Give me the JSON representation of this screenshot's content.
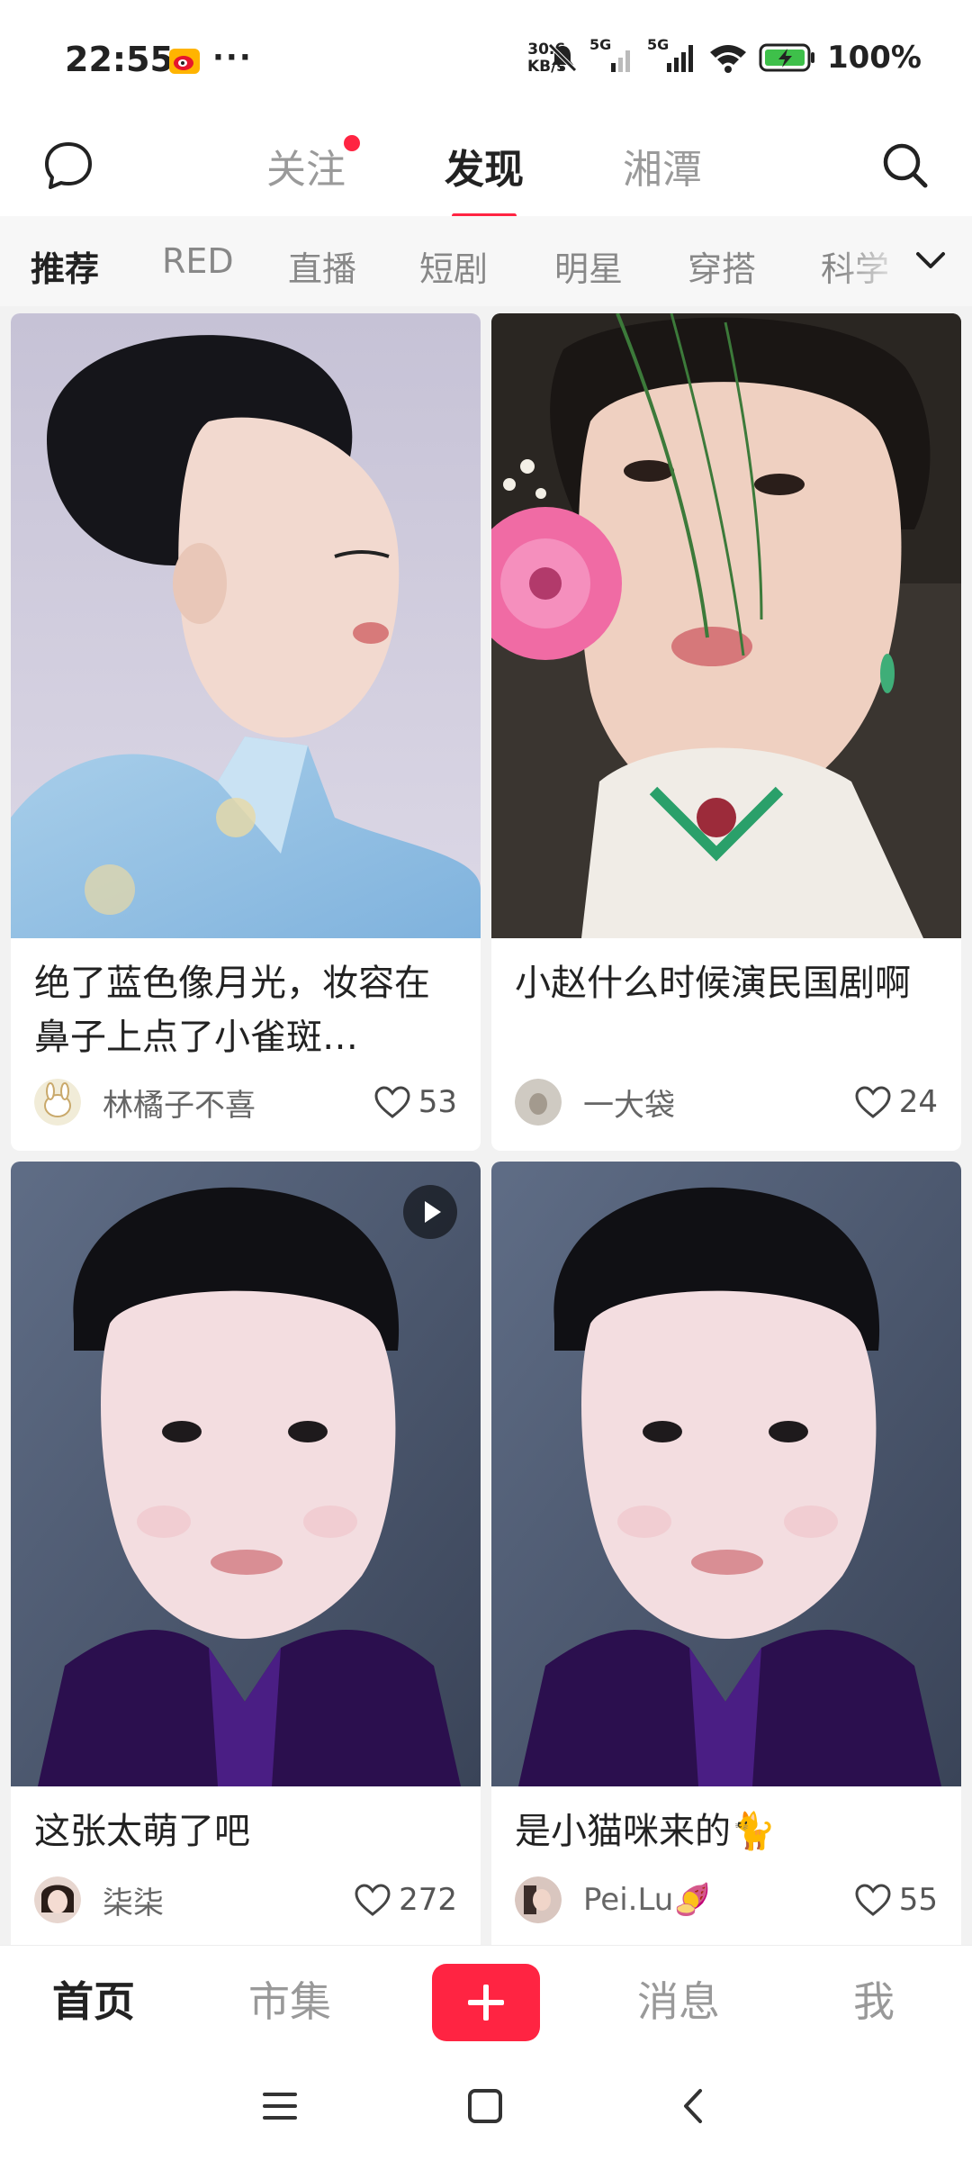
{
  "status_bar": {
    "time": "22:55",
    "more": "···",
    "speed_value": "30.6",
    "speed_unit": "KB/s",
    "signal_label_1": "5G",
    "signal_label_2": "5G",
    "battery_percent": "100%",
    "icons": [
      "weibo-icon",
      "mute-bell-icon",
      "signal-icon",
      "wifi-icon",
      "battery-icon"
    ]
  },
  "top_nav": {
    "tabs": [
      {
        "label": "关注",
        "active": false,
        "badge": true
      },
      {
        "label": "发现",
        "active": true
      },
      {
        "label": "湘潭",
        "active": false
      }
    ],
    "left_icon": "chat-bubble-icon",
    "right_icon": "search-icon"
  },
  "categories": [
    "推荐",
    "RED",
    "直播",
    "短剧",
    "明星",
    "穿搭",
    "科学"
  ],
  "active_category": "推荐",
  "feed": [
    {
      "title": "绝了蓝色像月光，妆容在鼻子上点了小雀斑…",
      "author": "林橘子不喜",
      "likes": "53",
      "video": false
    },
    {
      "title": "小赵什么时候演民国剧啊",
      "author": "一大袋",
      "likes": "24",
      "video": false
    },
    {
      "title": "这张太萌了吧",
      "author": "柒柒",
      "likes": "272",
      "video": true
    },
    {
      "title": "是小猫咪来的🐈",
      "author": "Pei.Lu🍠",
      "likes": "55",
      "video": false
    }
  ],
  "bottom_nav": {
    "home": "首页",
    "market": "市集",
    "messages": "消息",
    "me": "我",
    "plus_icon": "plus-icon"
  },
  "colors": {
    "accent": "#ff2442",
    "text_primary": "#222222",
    "text_muted": "#999999"
  }
}
